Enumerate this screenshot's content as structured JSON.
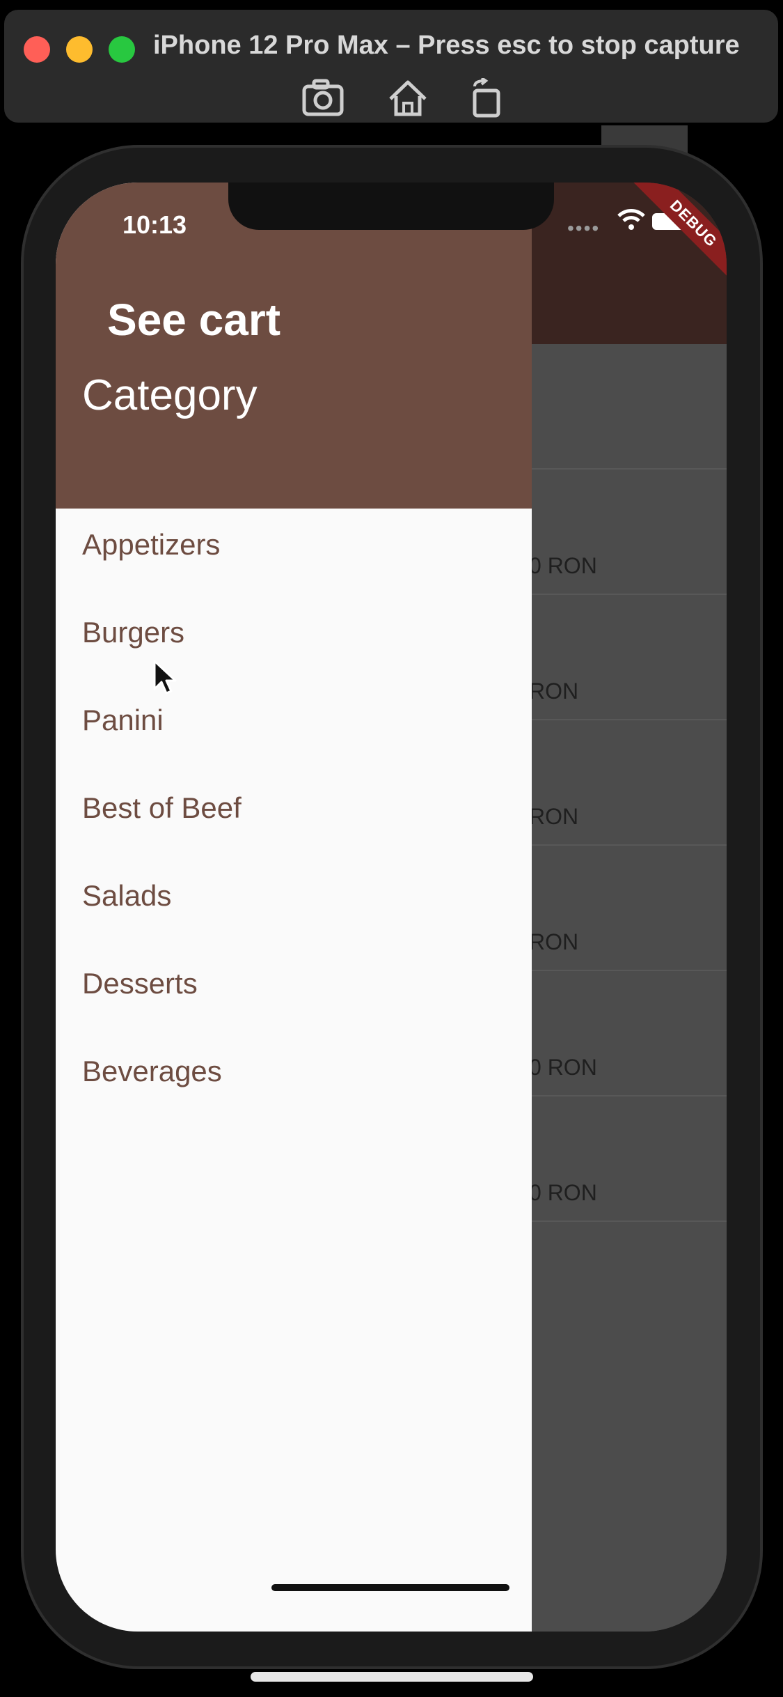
{
  "capture_window": {
    "title": "iPhone 12 Pro Max – Press esc to stop capture",
    "toolbar_icons": [
      "camera-icon",
      "home-icon",
      "rotate-icon"
    ]
  },
  "status_bar": {
    "time": "10:13",
    "debug_banner": "DEBUG"
  },
  "drawer": {
    "header_action": "See cart",
    "title": "Category",
    "items": [
      {
        "label": "Appetizers"
      },
      {
        "label": "Burgers"
      },
      {
        "label": "Panini"
      },
      {
        "label": "Best of Beef"
      },
      {
        "label": "Salads"
      },
      {
        "label": "Desserts"
      },
      {
        "label": "Beverages"
      }
    ]
  },
  "background_list": {
    "prices": [
      "0 RON",
      "RON",
      "RON",
      "RON",
      "0 RON",
      "0 RON"
    ]
  },
  "colors": {
    "drawer_header": "#6d4c41",
    "drawer_item_text": "#6d4c41",
    "drawer_bg": "#fafafa",
    "debug_banner": "#8a1f1f"
  }
}
